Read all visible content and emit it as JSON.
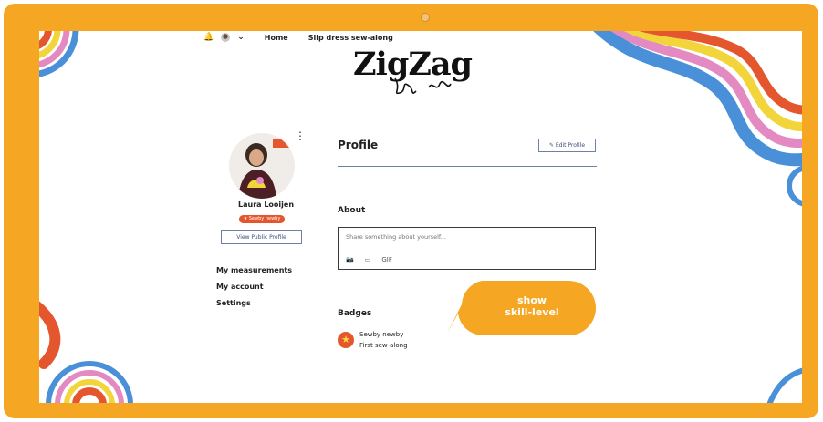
{
  "colors": {
    "frame": "#f5a623",
    "accent_orange": "#e4572e",
    "link_blue": "#3f4d7a",
    "swirl_blue": "#4a90d9",
    "swirl_pink": "#e38ac2",
    "swirl_yellow": "#f2d43b"
  },
  "topnav": {
    "bell_icon": "bell-icon",
    "chevron_icon": "chevron-down-icon",
    "home": "Home",
    "sewalong": "Slip dress sew-along"
  },
  "brand": {
    "logo": "ZigZag"
  },
  "sidebar": {
    "user_name": "Laura Looijen",
    "skill_badge": "★ Sewby newby",
    "view_public_profile": "View Public Profile",
    "more_icon": "⋮",
    "menu": [
      {
        "label": "My measurements"
      },
      {
        "label": "My account"
      },
      {
        "label": "Settings"
      }
    ]
  },
  "main": {
    "profile_title": "Profile",
    "edit_profile": "✎ Edit Profile",
    "about_title": "About",
    "about_placeholder": "Share something about yourself...",
    "about_tools": [
      "photo-icon",
      "video-icon",
      "gif-icon"
    ],
    "badges_title": "Badges",
    "badges": [
      {
        "name": "Sewby newby",
        "subtitle": "First sew-along",
        "icon": "star-icon"
      }
    ]
  },
  "callout": {
    "line1": "show",
    "line2": "skill-level"
  }
}
